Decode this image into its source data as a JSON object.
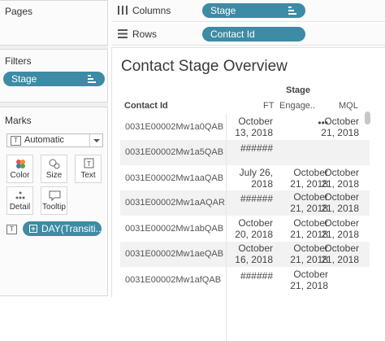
{
  "panels": {
    "pages": "Pages",
    "filters": "Filters",
    "marks": "Marks"
  },
  "filters": [
    {
      "label": "Stage"
    }
  ],
  "marks": {
    "type": "Automatic",
    "buttons": {
      "color": "Color",
      "size": "Size",
      "text": "Text",
      "detail": "Detail",
      "tooltip": "Tooltip"
    },
    "field": "DAY(Transiti.."
  },
  "shelves": {
    "columns": {
      "label": "Columns",
      "pill": "Stage"
    },
    "rows": {
      "label": "Rows",
      "pill": "Contact Id"
    }
  },
  "view": {
    "title": "Contact Stage Overview",
    "stage_header": "Stage",
    "row_header": "Contact Id",
    "columns": [
      "FT",
      "Engage..",
      "MQL"
    ],
    "rows": [
      {
        "id": "0031E00002Mw1a0QAB",
        "cells": [
          "October\n13, 2018",
          "•••",
          "October\n21, 2018"
        ]
      },
      {
        "id": "0031E00002Mw1a5QAB",
        "cells": [
          "######",
          "",
          ""
        ]
      },
      {
        "id": "0031E00002Mw1aaQAB",
        "cells": [
          "July 26,\n2018",
          "October\n21, 2018",
          "October\n21, 2018"
        ]
      },
      {
        "id": "0031E00002Mw1aAQAR",
        "cells": [
          "######",
          "October\n21, 2018",
          "October\n21, 2018"
        ]
      },
      {
        "id": "0031E00002Mw1abQAB",
        "cells": [
          "October\n20, 2018",
          "October\n21, 2018",
          "October\n21, 2018"
        ]
      },
      {
        "id": "0031E00002Mw1aeQAB",
        "cells": [
          "October\n16, 2018",
          "October\n21, 2018",
          "October\n21, 2018"
        ]
      },
      {
        "id": "0031E00002Mw1afQAB",
        "cells": [
          "######",
          "October\n21, 2018",
          ""
        ]
      }
    ]
  },
  "colors": {
    "pill": "#3d8ba5",
    "band": "#f2f2f2",
    "panel": "#f0f0f0"
  }
}
